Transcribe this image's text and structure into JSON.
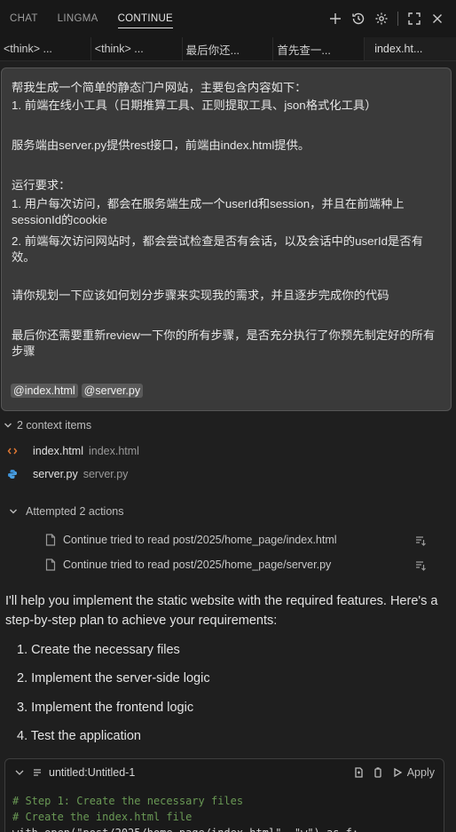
{
  "panel": {
    "tabs": [
      "CHAT",
      "LINGMA",
      "CONTINUE"
    ],
    "active_tab": "CONTINUE"
  },
  "editor_tabs": [
    "<think> ...",
    "<think> ...",
    "最后你还...",
    "首先查一...",
    "index.ht..."
  ],
  "user_message": {
    "lines": [
      "帮我生成一个简单的静态门户网站，主要包含内容如下：",
      "1. 前端在线小工具（日期推算工具、正则提取工具、json格式化工具）",
      "",
      "服务端由server.py提供rest接口，前端由index.html提供。",
      "",
      "运行要求：",
      "1. 用户每次访问，都会在服务端生成一个userId和session，并且在前端种上sessionId的cookie",
      "2. 前端每次访问网站时，都会尝试检查是否有会话，以及会话中的userId是否有效。",
      "",
      "请你规划一下应该如何划分步骤来实现我的需求，并且逐步完成你的代码",
      "",
      "最后你还需要重新review一下你的所有步骤，是否充分执行了你预先制定好的所有步骤"
    ],
    "mentions": [
      "@index.html",
      "@server.py"
    ]
  },
  "context": {
    "summary": "2 context items",
    "items": [
      {
        "name": "index.html",
        "path": "index.html",
        "icon": "html-icon"
      },
      {
        "name": "server.py",
        "path": "server.py",
        "icon": "python-icon"
      }
    ]
  },
  "actions": {
    "summary": "Attempted 2 actions",
    "items": [
      "Continue tried to read post/2025/home_page/index.html",
      "Continue tried to read post/2025/home_page/server.py"
    ]
  },
  "response": {
    "intro": "I'll help you implement the static website with the required features. Here's a step-by-step plan to achieve your requirements:",
    "steps": [
      "1. Create the necessary files",
      "2. Implement the server-side logic",
      "3. Implement the frontend logic",
      "4. Test the application"
    ]
  },
  "code_block": {
    "title": "untitled:Untitled-1",
    "apply_label": "Apply",
    "lines": [
      "# Step 1: Create the necessary files",
      "# Create the index.html file",
      "with open(\"post/2025/home_page/index.html\", \"w\") as f:"
    ]
  },
  "colors": {
    "background": "#1f1f1f",
    "message_box": "#3a3a3a",
    "html_icon": "#e37933",
    "python_icon": "#3c8fd3"
  }
}
